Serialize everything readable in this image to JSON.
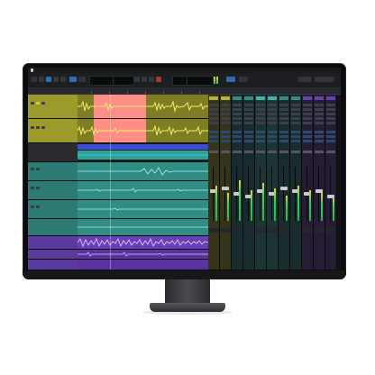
{
  "app": {
    "menu": [],
    "transport": {
      "counters": [
        {
          "value": "",
          "color": "green"
        },
        {
          "value": "",
          "color": "green"
        },
        {
          "value": "",
          "color": "red"
        },
        {
          "value": "",
          "color": "green"
        }
      ]
    }
  },
  "colors": {
    "screen_bg": "#101114",
    "track_yellow": "#b8b62e",
    "track_teal": "#2f8d86",
    "track_cyan": "#39b8b0",
    "track_blue": "#3b4fd0",
    "track_purple": "#6a3fb5",
    "selection": "#ff8f86",
    "meter_green": "#3fd05a"
  },
  "tracks": [
    {
      "color": "yellow"
    },
    {
      "color": "yellow"
    },
    {
      "color": "blue"
    },
    {
      "color": "teal"
    },
    {
      "color": "teal"
    },
    {
      "color": "teal"
    },
    {
      "color": "teal"
    },
    {
      "color": "purple"
    },
    {
      "color": "purple"
    },
    {
      "color": "purple"
    }
  ],
  "mixer": {
    "strips": [
      {
        "color": "#b8b62e",
        "fader": 0.55,
        "meter": 0.7
      },
      {
        "color": "#b8b62e",
        "fader": 0.6,
        "meter": 0.55
      },
      {
        "color": "#2f8d86",
        "fader": 0.5,
        "meter": 0.8
      },
      {
        "color": "#2f8d86",
        "fader": 0.45,
        "meter": 0.6
      },
      {
        "color": "#39b8b0",
        "fader": 0.55,
        "meter": 0.75
      },
      {
        "color": "#39b8b0",
        "fader": 0.5,
        "meter": 0.65
      },
      {
        "color": "#2f8d86",
        "fader": 0.6,
        "meter": 0.5
      },
      {
        "color": "#2f8d86",
        "fader": 0.55,
        "meter": 0.7
      },
      {
        "color": "#6a3fb5",
        "fader": 0.5,
        "meter": 0.6
      },
      {
        "color": "#6a3fb5",
        "fader": 0.55,
        "meter": 0.55
      },
      {
        "color": "#6a3fb5",
        "fader": 0.45,
        "meter": 0.45
      }
    ]
  }
}
